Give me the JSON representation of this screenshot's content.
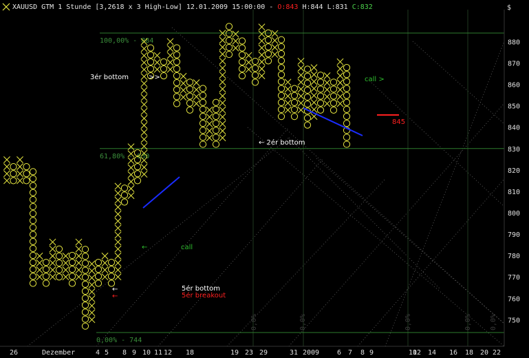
{
  "header": {
    "icon": "x-mark-icon",
    "symbol": "XAUUSD GTM 1 Stunde [3,2618 x 3 High-Low]",
    "datetime": "12.01.2009 15:00:00 -",
    "open": "O:843",
    "high": "H:844",
    "low": "L:831",
    "close": "C:832",
    "currency": "$"
  },
  "colors": {
    "background": "#000000",
    "x_mark": "#e8e840",
    "o_mark": "#e8e840",
    "fib_line": "#2e7d2e",
    "fib_text": "#3b8f3b",
    "grid": "#1f3a1f",
    "diag": "#555555",
    "trend": "#1a2cff",
    "red": "#ff2020",
    "white": "#ffffff",
    "call_green": "#2fbf2f",
    "axis_text": "#e0e0e0"
  },
  "chart_data": {
    "type": "point-and-figure",
    "box_size": 3.2618,
    "reversal": 3,
    "ylim": [
      744,
      884
    ],
    "y_ticks": [
      750,
      760,
      770,
      780,
      790,
      800,
      810,
      820,
      830,
      840,
      850,
      860,
      870,
      880
    ],
    "x_ticks": [
      "26",
      "Dezember",
      "4",
      "5",
      "8",
      "9",
      "10",
      "11",
      "12",
      "18",
      "19",
      "23",
      "29",
      "31",
      "2009",
      "6",
      "7",
      "8",
      "9",
      "10",
      "12",
      "14",
      "16",
      "18",
      "20",
      "22"
    ],
    "fib_levels": [
      {
        "label": "100,00% - 884",
        "value": 884
      },
      {
        "label": "61,80% - 830",
        "value": 830
      },
      {
        "label": "0,00% - 744",
        "value": 744
      }
    ],
    "columns": [
      {
        "type": "X",
        "low": 815,
        "high": 824
      },
      {
        "type": "O",
        "low": 815,
        "high": 821
      },
      {
        "type": "X",
        "low": 815,
        "high": 824
      },
      {
        "type": "O",
        "low": 815,
        "high": 821
      },
      {
        "type": "O",
        "low": 767,
        "high": 818
      },
      {
        "type": "X",
        "low": 770,
        "high": 780
      },
      {
        "type": "O",
        "low": 767,
        "high": 777
      },
      {
        "type": "X",
        "low": 770,
        "high": 786
      },
      {
        "type": "O",
        "low": 770,
        "high": 783
      },
      {
        "type": "X",
        "low": 770,
        "high": 780
      },
      {
        "type": "O",
        "low": 767,
        "high": 780
      },
      {
        "type": "X",
        "low": 770,
        "high": 786
      },
      {
        "type": "O",
        "low": 747,
        "high": 783
      },
      {
        "type": "X",
        "low": 750,
        "high": 777
      },
      {
        "type": "O",
        "low": 767,
        "high": 777
      },
      {
        "type": "X",
        "low": 770,
        "high": 780
      },
      {
        "type": "O",
        "low": 767,
        "high": 777
      },
      {
        "type": "X",
        "low": 770,
        "high": 812
      },
      {
        "type": "O",
        "low": 805,
        "high": 812
      },
      {
        "type": "X",
        "low": 808,
        "high": 830
      },
      {
        "type": "O",
        "low": 815,
        "high": 827
      },
      {
        "type": "X",
        "low": 818,
        "high": 880
      },
      {
        "type": "O",
        "low": 864,
        "high": 877
      },
      {
        "type": "X",
        "low": 867,
        "high": 874
      },
      {
        "type": "O",
        "low": 864,
        "high": 871
      },
      {
        "type": "X",
        "low": 867,
        "high": 880
      },
      {
        "type": "O",
        "low": 851,
        "high": 877
      },
      {
        "type": "X",
        "low": 854,
        "high": 864
      },
      {
        "type": "O",
        "low": 848,
        "high": 861
      },
      {
        "type": "X",
        "low": 851,
        "high": 861
      },
      {
        "type": "O",
        "low": 832,
        "high": 858
      },
      {
        "type": "X",
        "low": 835,
        "high": 848
      },
      {
        "type": "O",
        "low": 832,
        "high": 851
      },
      {
        "type": "X",
        "low": 835,
        "high": 884
      },
      {
        "type": "O",
        "low": 874,
        "high": 887
      },
      {
        "type": "X",
        "low": 877,
        "high": 884
      },
      {
        "type": "O",
        "low": 864,
        "high": 880
      },
      {
        "type": "X",
        "low": 867,
        "high": 874
      },
      {
        "type": "O",
        "low": 861,
        "high": 871
      },
      {
        "type": "X",
        "low": 864,
        "high": 887
      },
      {
        "type": "O",
        "low": 871,
        "high": 884
      },
      {
        "type": "X",
        "low": 874,
        "high": 884
      },
      {
        "type": "O",
        "low": 845,
        "high": 880
      },
      {
        "type": "X",
        "low": 848,
        "high": 861
      },
      {
        "type": "O",
        "low": 845,
        "high": 858
      },
      {
        "type": "X",
        "low": 848,
        "high": 871
      },
      {
        "type": "O",
        "low": 841,
        "high": 867
      },
      {
        "type": "X",
        "low": 845,
        "high": 867
      },
      {
        "type": "O",
        "low": 848,
        "high": 864
      },
      {
        "type": "X",
        "low": 851,
        "high": 864
      },
      {
        "type": "O",
        "low": 848,
        "high": 861
      },
      {
        "type": "X",
        "low": 851,
        "high": 871
      },
      {
        "type": "O",
        "low": 832,
        "high": 867
      }
    ],
    "annotations": [
      {
        "text": "3ér bottom",
        "color": "white"
      },
      {
        "text": ">>",
        "color": "white"
      },
      {
        "text": "← 2ér bottom",
        "color": "white"
      },
      {
        "text": "←",
        "color": "call_green"
      },
      {
        "text": "call",
        "color": "call_green"
      },
      {
        "text": "call >",
        "color": "call_green"
      },
      {
        "text": "5ér bottom",
        "color": "white"
      },
      {
        "text": "5ér breakout",
        "color": "red"
      },
      {
        "text": "←",
        "color": "white"
      },
      {
        "text": "←",
        "color": "red"
      },
      {
        "text": "845",
        "color": "red"
      }
    ],
    "diagonal_labels": [
      "0,0%",
      "0,0%",
      "0,0%",
      "0,0%",
      "0,0%"
    ]
  }
}
